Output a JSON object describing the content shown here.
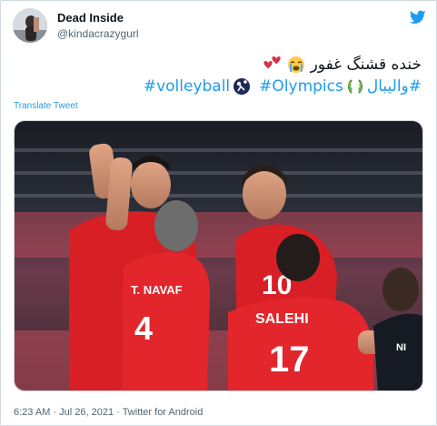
{
  "user": {
    "display_name": "Dead Inside",
    "handle": "@kindacrazygurl",
    "avatar_icon": "avatar-photo"
  },
  "logo": {
    "icon": "twitter-bird-icon",
    "color": "#1d9bf0"
  },
  "tweet": {
    "line1_text": "خنده قشنگ غفور",
    "line1_emojis": [
      "loudly-crying-face-emoji",
      "heart-emoji",
      "heart-emoji"
    ],
    "hashtag_1": "#والیبال",
    "hashtag_2": "#Olympics",
    "hashtag_3": "#volleyball",
    "laurel_emoji": "laurel-wreath-emoji",
    "volleyball_emoji": "volleyball-emoji"
  },
  "translate_label": "Translate Tweet",
  "photo": {
    "jersey_names": [
      "T. NAVAF",
      "SALEHI",
      "NI"
    ],
    "jersey_numbers": [
      "4",
      "10",
      "17"
    ]
  },
  "meta": {
    "time": "6:23 AM",
    "separator": "·",
    "date": "Jul 26, 2021",
    "source": "Twitter for Android"
  },
  "colors": {
    "link": "#1d9bf0",
    "text": "#0f1419",
    "secondary": "#536471",
    "jersey_red": "#d81f26"
  }
}
